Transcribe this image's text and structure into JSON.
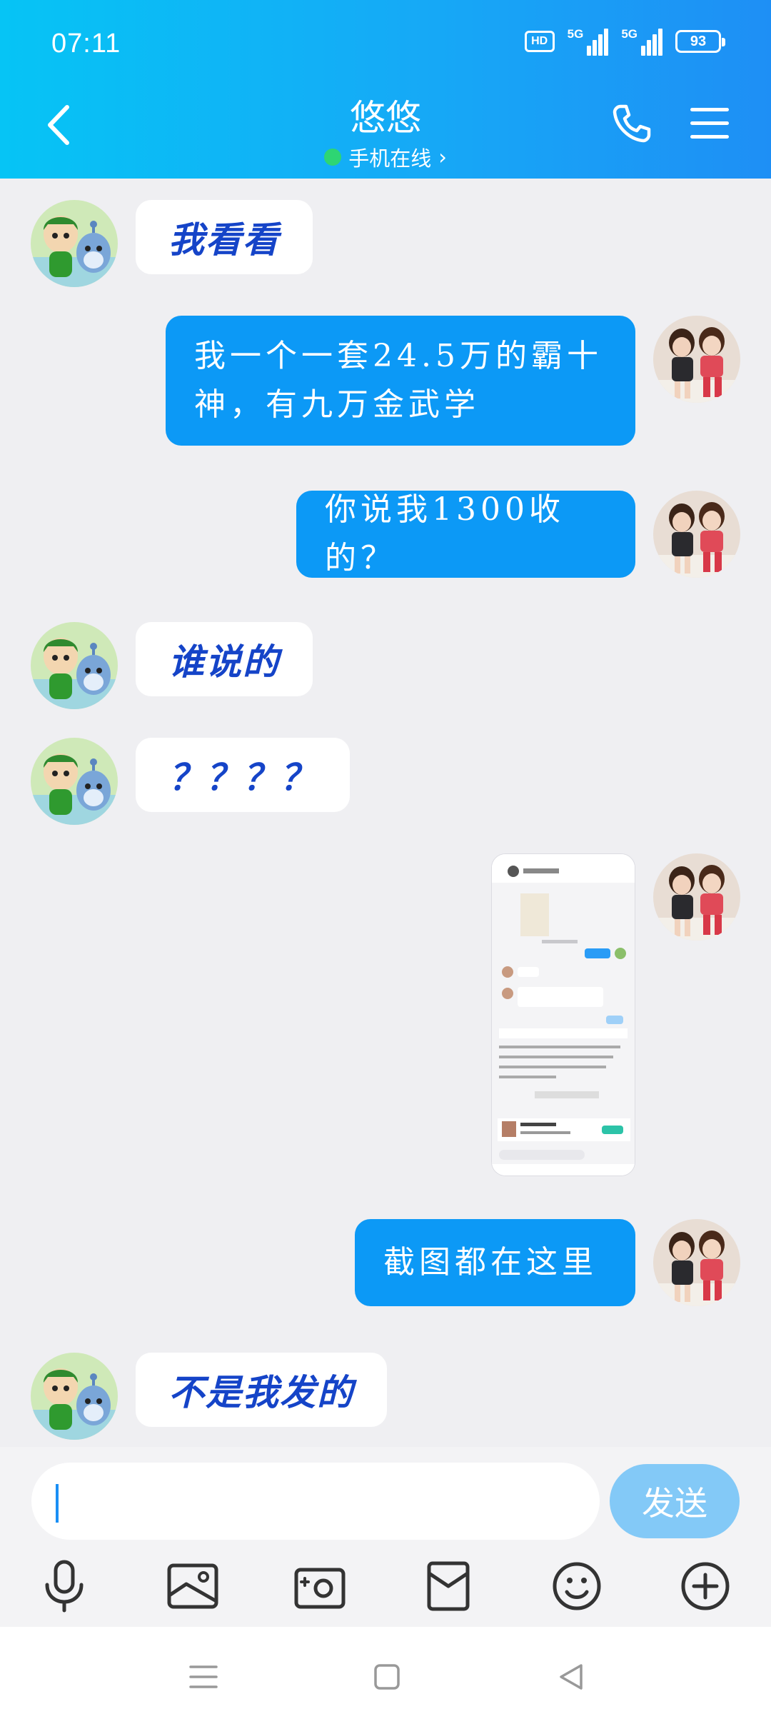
{
  "status_bar": {
    "time": "07:11",
    "hd": "HD",
    "signal1": "5G",
    "signal2": "5G",
    "battery": "93"
  },
  "header": {
    "title": "悠悠",
    "status": "手机在线",
    "status_arrow": "›",
    "online_color": "#2ed573",
    "gradient": [
      "#06c4f5",
      "#1e8ff5"
    ]
  },
  "messages": [
    {
      "side": "in",
      "text": "我看看"
    },
    {
      "side": "out",
      "text": "我一个一套24.5万的霸十神，有九万金武学"
    },
    {
      "side": "out",
      "text": "你说我1300收的？"
    },
    {
      "side": "in",
      "text": "谁说的"
    },
    {
      "side": "in",
      "text": "？？？？"
    },
    {
      "side": "out",
      "type": "image",
      "text": "screenshot"
    },
    {
      "side": "out",
      "text": "截图都在这里"
    },
    {
      "side": "in",
      "text": "不是我发的"
    }
  ],
  "input": {
    "value": "",
    "send_label": "发送"
  },
  "toolbar": {
    "icons": [
      "microphone-icon",
      "image-icon",
      "camera-icon",
      "red-packet-icon",
      "emoji-icon",
      "plus-icon"
    ]
  },
  "colors": {
    "in_text": "#1544c8",
    "out_bubble": "#0c99f6",
    "background": "#efeff2",
    "send_disabled": "#83c9f7"
  }
}
